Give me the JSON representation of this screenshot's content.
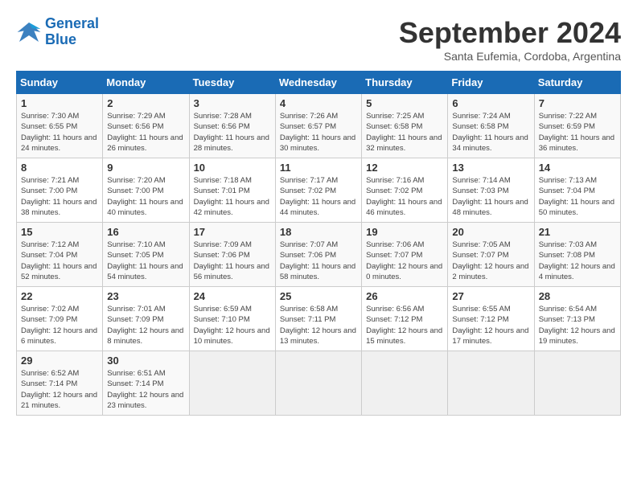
{
  "header": {
    "logo_line1": "General",
    "logo_line2": "Blue",
    "month_title": "September 2024",
    "location": "Santa Eufemia, Cordoba, Argentina"
  },
  "weekdays": [
    "Sunday",
    "Monday",
    "Tuesday",
    "Wednesday",
    "Thursday",
    "Friday",
    "Saturday"
  ],
  "weeks": [
    [
      {
        "day": "1",
        "sunrise": "Sunrise: 7:30 AM",
        "sunset": "Sunset: 6:55 PM",
        "daylight": "Daylight: 11 hours and 24 minutes."
      },
      {
        "day": "2",
        "sunrise": "Sunrise: 7:29 AM",
        "sunset": "Sunset: 6:56 PM",
        "daylight": "Daylight: 11 hours and 26 minutes."
      },
      {
        "day": "3",
        "sunrise": "Sunrise: 7:28 AM",
        "sunset": "Sunset: 6:56 PM",
        "daylight": "Daylight: 11 hours and 28 minutes."
      },
      {
        "day": "4",
        "sunrise": "Sunrise: 7:26 AM",
        "sunset": "Sunset: 6:57 PM",
        "daylight": "Daylight: 11 hours and 30 minutes."
      },
      {
        "day": "5",
        "sunrise": "Sunrise: 7:25 AM",
        "sunset": "Sunset: 6:58 PM",
        "daylight": "Daylight: 11 hours and 32 minutes."
      },
      {
        "day": "6",
        "sunrise": "Sunrise: 7:24 AM",
        "sunset": "Sunset: 6:58 PM",
        "daylight": "Daylight: 11 hours and 34 minutes."
      },
      {
        "day": "7",
        "sunrise": "Sunrise: 7:22 AM",
        "sunset": "Sunset: 6:59 PM",
        "daylight": "Daylight: 11 hours and 36 minutes."
      }
    ],
    [
      {
        "day": "8",
        "sunrise": "Sunrise: 7:21 AM",
        "sunset": "Sunset: 7:00 PM",
        "daylight": "Daylight: 11 hours and 38 minutes."
      },
      {
        "day": "9",
        "sunrise": "Sunrise: 7:20 AM",
        "sunset": "Sunset: 7:00 PM",
        "daylight": "Daylight: 11 hours and 40 minutes."
      },
      {
        "day": "10",
        "sunrise": "Sunrise: 7:18 AM",
        "sunset": "Sunset: 7:01 PM",
        "daylight": "Daylight: 11 hours and 42 minutes."
      },
      {
        "day": "11",
        "sunrise": "Sunrise: 7:17 AM",
        "sunset": "Sunset: 7:02 PM",
        "daylight": "Daylight: 11 hours and 44 minutes."
      },
      {
        "day": "12",
        "sunrise": "Sunrise: 7:16 AM",
        "sunset": "Sunset: 7:02 PM",
        "daylight": "Daylight: 11 hours and 46 minutes."
      },
      {
        "day": "13",
        "sunrise": "Sunrise: 7:14 AM",
        "sunset": "Sunset: 7:03 PM",
        "daylight": "Daylight: 11 hours and 48 minutes."
      },
      {
        "day": "14",
        "sunrise": "Sunrise: 7:13 AM",
        "sunset": "Sunset: 7:04 PM",
        "daylight": "Daylight: 11 hours and 50 minutes."
      }
    ],
    [
      {
        "day": "15",
        "sunrise": "Sunrise: 7:12 AM",
        "sunset": "Sunset: 7:04 PM",
        "daylight": "Daylight: 11 hours and 52 minutes."
      },
      {
        "day": "16",
        "sunrise": "Sunrise: 7:10 AM",
        "sunset": "Sunset: 7:05 PM",
        "daylight": "Daylight: 11 hours and 54 minutes."
      },
      {
        "day": "17",
        "sunrise": "Sunrise: 7:09 AM",
        "sunset": "Sunset: 7:06 PM",
        "daylight": "Daylight: 11 hours and 56 minutes."
      },
      {
        "day": "18",
        "sunrise": "Sunrise: 7:07 AM",
        "sunset": "Sunset: 7:06 PM",
        "daylight": "Daylight: 11 hours and 58 minutes."
      },
      {
        "day": "19",
        "sunrise": "Sunrise: 7:06 AM",
        "sunset": "Sunset: 7:07 PM",
        "daylight": "Daylight: 12 hours and 0 minutes."
      },
      {
        "day": "20",
        "sunrise": "Sunrise: 7:05 AM",
        "sunset": "Sunset: 7:07 PM",
        "daylight": "Daylight: 12 hours and 2 minutes."
      },
      {
        "day": "21",
        "sunrise": "Sunrise: 7:03 AM",
        "sunset": "Sunset: 7:08 PM",
        "daylight": "Daylight: 12 hours and 4 minutes."
      }
    ],
    [
      {
        "day": "22",
        "sunrise": "Sunrise: 7:02 AM",
        "sunset": "Sunset: 7:09 PM",
        "daylight": "Daylight: 12 hours and 6 minutes."
      },
      {
        "day": "23",
        "sunrise": "Sunrise: 7:01 AM",
        "sunset": "Sunset: 7:09 PM",
        "daylight": "Daylight: 12 hours and 8 minutes."
      },
      {
        "day": "24",
        "sunrise": "Sunrise: 6:59 AM",
        "sunset": "Sunset: 7:10 PM",
        "daylight": "Daylight: 12 hours and 10 minutes."
      },
      {
        "day": "25",
        "sunrise": "Sunrise: 6:58 AM",
        "sunset": "Sunset: 7:11 PM",
        "daylight": "Daylight: 12 hours and 13 minutes."
      },
      {
        "day": "26",
        "sunrise": "Sunrise: 6:56 AM",
        "sunset": "Sunset: 7:12 PM",
        "daylight": "Daylight: 12 hours and 15 minutes."
      },
      {
        "day": "27",
        "sunrise": "Sunrise: 6:55 AM",
        "sunset": "Sunset: 7:12 PM",
        "daylight": "Daylight: 12 hours and 17 minutes."
      },
      {
        "day": "28",
        "sunrise": "Sunrise: 6:54 AM",
        "sunset": "Sunset: 7:13 PM",
        "daylight": "Daylight: 12 hours and 19 minutes."
      }
    ],
    [
      {
        "day": "29",
        "sunrise": "Sunrise: 6:52 AM",
        "sunset": "Sunset: 7:14 PM",
        "daylight": "Daylight: 12 hours and 21 minutes."
      },
      {
        "day": "30",
        "sunrise": "Sunrise: 6:51 AM",
        "sunset": "Sunset: 7:14 PM",
        "daylight": "Daylight: 12 hours and 23 minutes."
      },
      null,
      null,
      null,
      null,
      null
    ]
  ]
}
